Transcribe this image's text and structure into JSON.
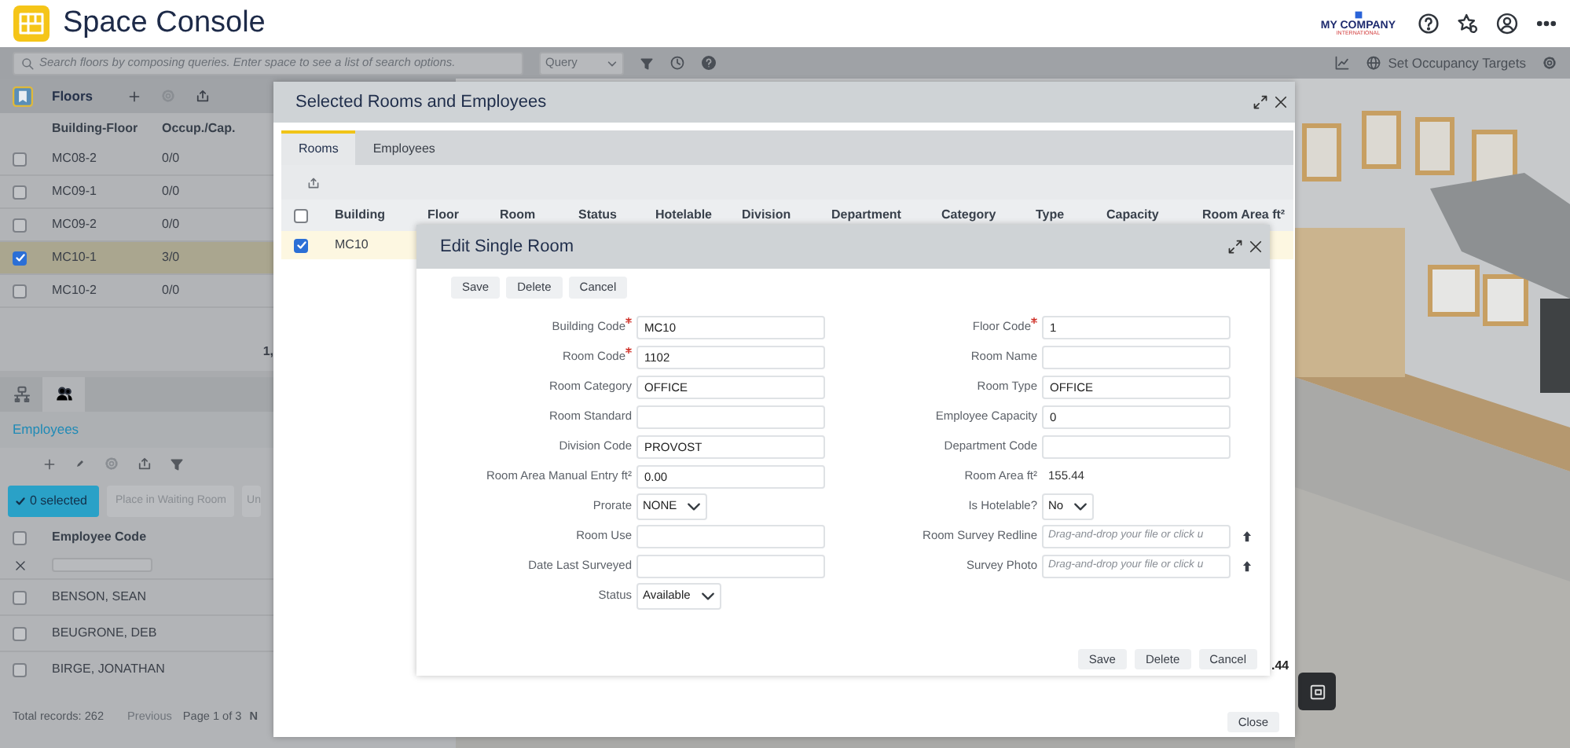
{
  "app": {
    "title": "Space Console",
    "company": "MY COMPANY",
    "company_sub": "INTERNATIONAL"
  },
  "toolbar": {
    "search_placeholder": "Search floors by composing queries. Enter space to see a list of search options.",
    "query": "Query",
    "action": "Set Occupancy Targets"
  },
  "floors_panel": {
    "title": "Floors",
    "columns": [
      "Building-Floor",
      "Occup./Cap."
    ],
    "rows": [
      {
        "cells": [
          "MC08-2",
          "0/0"
        ],
        "checked": false
      },
      {
        "cells": [
          "MC09-1",
          "0/0"
        ],
        "checked": false
      },
      {
        "cells": [
          "MC09-2",
          "0/0"
        ],
        "checked": false
      },
      {
        "cells": [
          "MC10-1",
          "3/0"
        ],
        "checked": true
      },
      {
        "cells": [
          "MC10-2",
          "0/0"
        ],
        "checked": false
      }
    ],
    "pager": "1,"
  },
  "side_tabs": [
    {
      "selected": false
    },
    {
      "selected": true
    }
  ],
  "employees_panel": {
    "title": "Employees",
    "selected_button": "0 selected",
    "buttons": [
      "Place in Waiting Room",
      "Un"
    ],
    "header_checked": false,
    "column": "Employee Code",
    "rows": [
      {
        "name": "BENSON, SEAN",
        "checked": false
      },
      {
        "name": "BEUGRONE, DEB",
        "checked": false
      },
      {
        "name": "BIRGE, JONATHAN",
        "checked": false
      }
    ],
    "total": "Total records: 262",
    "previous": "Previous",
    "page": "Page 1 of 3",
    "next": "N"
  },
  "rooms_dialog": {
    "title": "Selected Rooms and Employees",
    "tabs": [
      {
        "label": "Rooms",
        "selected": true
      },
      {
        "label": "Employees",
        "selected": false
      }
    ],
    "header_checked": false,
    "columns": [
      "Building",
      "Floor",
      "Room",
      "Status",
      "Hotelable",
      "Division",
      "Department",
      "Category",
      "Type",
      "Capacity",
      "Room Area ft²"
    ],
    "rows": [
      {
        "checked": true,
        "cells": [
          "MC10"
        ]
      }
    ],
    "area_value": ".44",
    "close": "Close"
  },
  "edit_dialog": {
    "title": "Edit Single Room",
    "top_buttons": [
      "Save",
      "Delete",
      "Cancel"
    ],
    "left_fields": [
      {
        "kind": "text",
        "label": "Building Code",
        "required": true,
        "value": "MC10"
      },
      {
        "kind": "text",
        "label": "Room Code",
        "required": true,
        "value": "1102"
      },
      {
        "kind": "text",
        "label": "Room Category",
        "required": false,
        "value": "OFFICE"
      },
      {
        "kind": "text",
        "label": "Room Standard",
        "required": false
      },
      {
        "kind": "text",
        "label": "Division Code",
        "required": false,
        "value": "PROVOST"
      },
      {
        "kind": "text",
        "label": "Room Area Manual Entry ft²",
        "required": false,
        "value": "0.00"
      },
      {
        "kind": "select",
        "label": "Prorate",
        "required": false,
        "value": "NONE"
      },
      {
        "kind": "text",
        "label": "Room Use",
        "required": false
      },
      {
        "kind": "text",
        "label": "Date Last Surveyed",
        "required": false
      },
      {
        "kind": "select",
        "label": "Status",
        "required": false,
        "value": "Available"
      }
    ],
    "right_fields": [
      {
        "kind": "text",
        "label": "Floor Code",
        "required": true,
        "value": "1"
      },
      {
        "kind": "text",
        "label": "Room Name",
        "required": false
      },
      {
        "kind": "text",
        "label": "Room Type",
        "required": false,
        "value": "OFFICE"
      },
      {
        "kind": "text",
        "label": "Employee Capacity",
        "required": false,
        "value": "0"
      },
      {
        "kind": "text",
        "label": "Department Code",
        "required": false
      },
      {
        "kind": "static",
        "label": "Room Area ft²",
        "required": false,
        "value": "155.44"
      },
      {
        "kind": "select",
        "label": "Is Hotelable?",
        "required": false,
        "value": "No"
      },
      {
        "kind": "file",
        "label": "Room Survey Redline",
        "required": false,
        "placeholder": "Drag-and-drop your file or click u"
      },
      {
        "kind": "file",
        "label": "Survey Photo",
        "required": false,
        "placeholder": "Drag-and-drop your file or click u"
      }
    ],
    "bottom_buttons": [
      "Save",
      "Delete",
      "Cancel"
    ]
  }
}
